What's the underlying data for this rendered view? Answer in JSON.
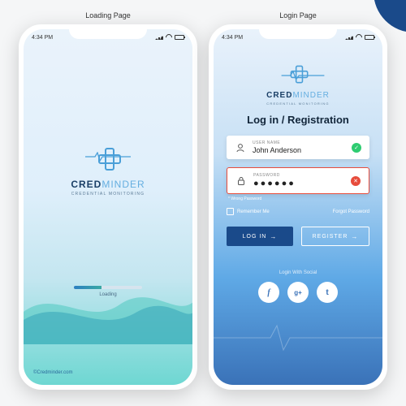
{
  "colors": {
    "brand_dark": "#1a4a8a",
    "brand_light": "#65aee0",
    "success": "#2ecc71",
    "error": "#e74c3c"
  },
  "statusbar": {
    "time": "4:34 PM"
  },
  "brand": {
    "name_bold": "CRED",
    "name_thin": "MINDER",
    "tagline": "CREDENTIAL MONITORING",
    "url": "©Credminder.com"
  },
  "pages": {
    "loading": {
      "label": "Loading Page",
      "progress_label": "Loading"
    },
    "login": {
      "label": "Login Page",
      "title": "Log in / Registration",
      "username": {
        "label": "USER NAME",
        "value": "John Anderson"
      },
      "password": {
        "label": "PASSWORD",
        "value_masked": "●●●●●●",
        "error_msg": "* Wrong Password"
      },
      "remember_label": "Remember Me",
      "forgot_label": "Forgot Password",
      "login_btn": "LOG IN",
      "register_btn": "REGISTER",
      "social_label": "Login With Social",
      "social": {
        "fb": "f",
        "g": "g+",
        "tw": "t"
      }
    }
  }
}
